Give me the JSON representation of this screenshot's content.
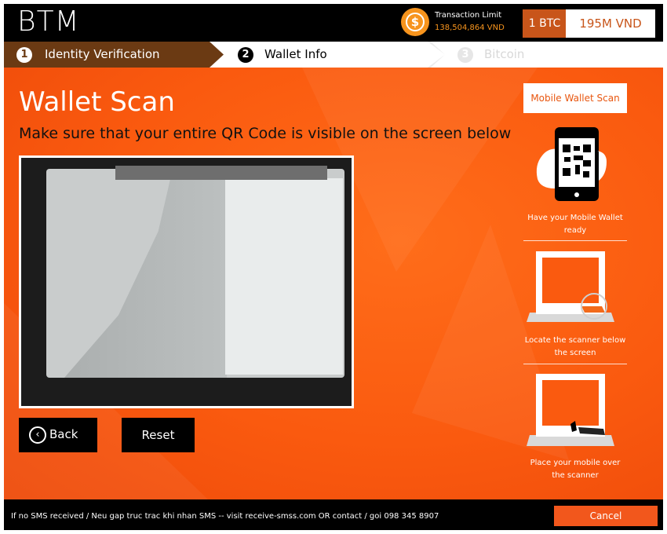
{
  "app": {
    "logo": "BTM"
  },
  "header": {
    "limit_title": "Transaction Limit",
    "limit_value": "138,504,864 VND",
    "limit_icon": "dollar-coin-icon",
    "rate_btc": "1 BTC",
    "rate_vnd": "195M VND"
  },
  "steps": [
    {
      "num": "1",
      "label": "Identity Verification",
      "state": "done"
    },
    {
      "num": "2",
      "label": "Wallet Info",
      "state": "active"
    },
    {
      "num": "3",
      "label": "Bitcoin",
      "state": "pending"
    }
  ],
  "main": {
    "title": "Wallet Scan",
    "subtitle": "Make sure that your entire QR Code is visible on the screen below",
    "back_label": "Back",
    "back_icon": "circle-chevron-left-icon",
    "reset_label": "Reset"
  },
  "side": {
    "scan_button": "Mobile Wallet Scan",
    "instructions": [
      {
        "icon": "phone-qr-icon",
        "caption": "Have your Mobile Wallet ready"
      },
      {
        "icon": "kiosk-scanner-icon",
        "caption": "Locate the scanner below the screen"
      },
      {
        "icon": "kiosk-phone-icon",
        "caption": "Place your mobile over the scanner"
      }
    ]
  },
  "footer": {
    "text": "If no SMS received / Neu gap truc trac khi nhan SMS -- visit receive-smss.com OR contact / goi 098 345 8907",
    "cancel_label": "Cancel"
  },
  "colors": {
    "accent": "#fa5a0f",
    "step_done": "#6b3a13",
    "rate_bg": "#c8551a",
    "limit_text": "#f7941d"
  }
}
